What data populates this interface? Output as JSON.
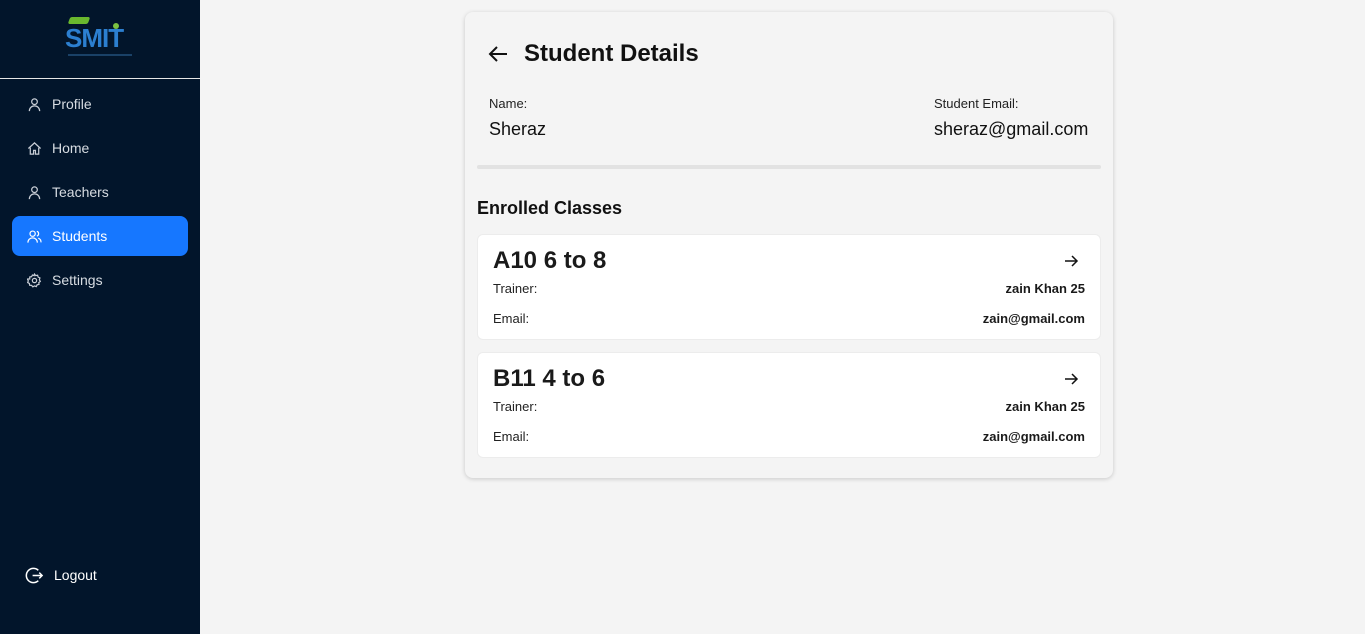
{
  "sidebar": {
    "logo_text": "SMIT",
    "items": [
      {
        "label": "Profile",
        "icon": "user-icon",
        "active": false
      },
      {
        "label": "Home",
        "icon": "home-icon",
        "active": false
      },
      {
        "label": "Teachers",
        "icon": "user-icon",
        "active": false
      },
      {
        "label": "Students",
        "icon": "users-icon",
        "active": true
      },
      {
        "label": "Settings",
        "icon": "gear-icon",
        "active": false
      }
    ],
    "logout_label": "Logout"
  },
  "page": {
    "title": "Student Details",
    "name_label": "Name:",
    "name_value": "Sheraz",
    "email_label": "Student Email:",
    "email_value": "sheraz@gmail.com",
    "section_title": "Enrolled Classes"
  },
  "classes": [
    {
      "name": "A10 6 to 8",
      "trainer_label": "Trainer:",
      "trainer": "zain Khan 25",
      "email_label": "Email:",
      "email": "zain@gmail.com"
    },
    {
      "name": "B11 4 to 6",
      "trainer_label": "Trainer:",
      "trainer": "zain Khan 25",
      "email_label": "Email:",
      "email": "zain@gmail.com"
    }
  ],
  "colors": {
    "sidebar_bg": "#02152b",
    "accent": "#1677ff",
    "page_bg": "#f4f4f4"
  }
}
